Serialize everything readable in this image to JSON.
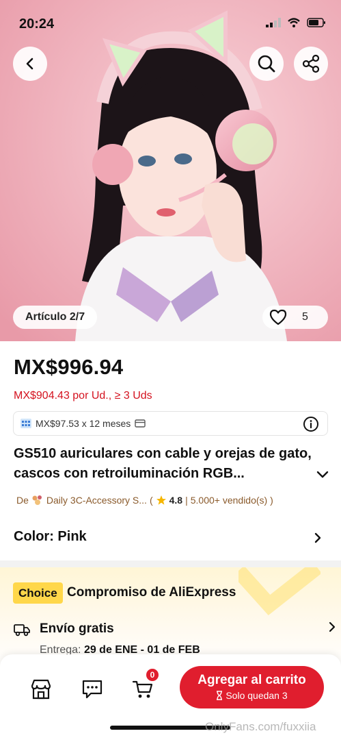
{
  "status_bar": {
    "time": "20:24"
  },
  "hero": {
    "article_label": "Artículo 2/7",
    "favorites_count": "5"
  },
  "product": {
    "price": "MX$996.94",
    "bulk_price": "MX$904.43 por Ud., ≥ 3 Uds",
    "installments": "MX$97.53 x 12 meses",
    "title": "GS510 auriculares con cable y orejas de gato, cascos con retroiluminación RGB...",
    "seller_prefix": "De",
    "seller_name": "Daily 3C-Accessory S...",
    "rating": "4.8",
    "sold": "5.000+ vendido(s) )",
    "color_label": "Color: Pink"
  },
  "choice": {
    "badge": "Choice",
    "title": "Compromiso de AliExpress",
    "shipping_title": "Envío gratis",
    "delivery_prefix": "Entrega:",
    "delivery_dates": "29 de ENE - 01 de FEB"
  },
  "bottom_bar": {
    "cart_count": "0",
    "add_to_cart": "Agregar al carrito",
    "stock_note": "Solo quedan 3",
    "watermark": "OnlyFans.com/fuxxiia"
  },
  "colors": {
    "accent_red": "#e01e2e",
    "choice_yellow": "#ffd74a",
    "seller_brown": "#8a5a2b"
  }
}
